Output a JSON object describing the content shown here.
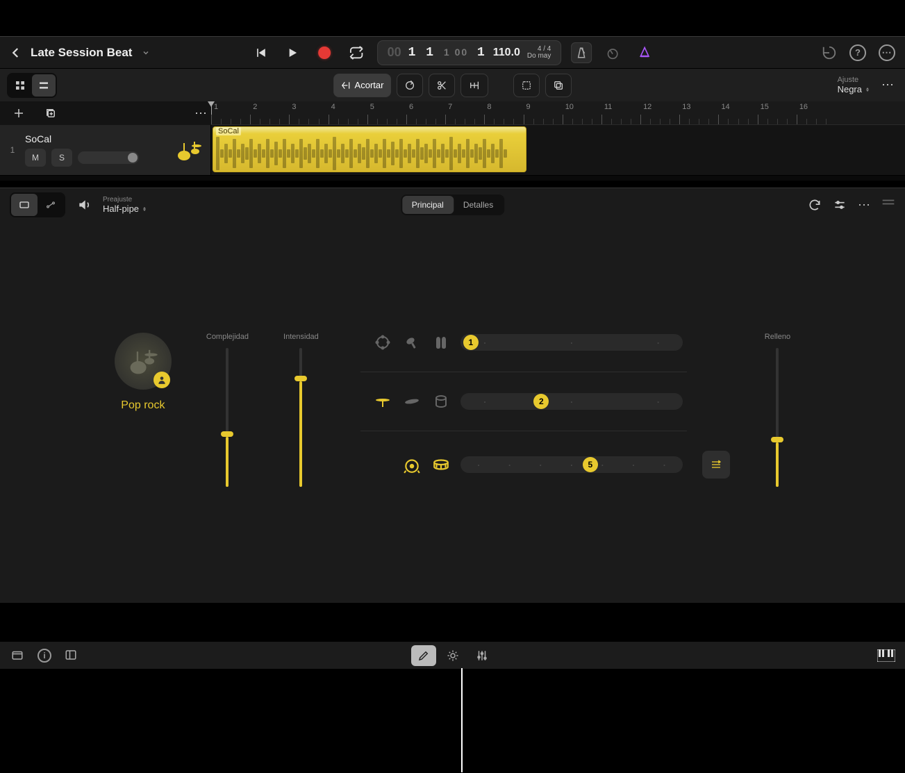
{
  "project": {
    "title": "Late Session Beat"
  },
  "transport": {
    "position": "1 1 1 1",
    "position_dim_prefix": "00",
    "tempo": "110.0",
    "signature": "4 / 4",
    "key": "Do may"
  },
  "tracks_toolbar": {
    "trim_label": "Acortar",
    "adjust_label": "Ajuste",
    "adjust_value": "Negra"
  },
  "ruler": {
    "bars": [
      "1",
      "2",
      "3",
      "4",
      "5",
      "6",
      "7",
      "8",
      "9",
      "10",
      "11",
      "12",
      "13",
      "14",
      "15",
      "16"
    ]
  },
  "track": {
    "index": "1",
    "name": "SoCal",
    "mute": "M",
    "solo": "S",
    "region_label": "SoCal"
  },
  "editor": {
    "preset_label": "Preajuste",
    "preset_value": "Half-pipe",
    "tab_main": "Principal",
    "tab_details": "Detalles",
    "style_label": "Pop rock",
    "slider_complexity": "Complejidad",
    "slider_intensity": "Intensidad",
    "slider_fill": "Relleno",
    "kit_row1_value": "1",
    "kit_row2_value": "2",
    "kit_row3_value": "5"
  }
}
